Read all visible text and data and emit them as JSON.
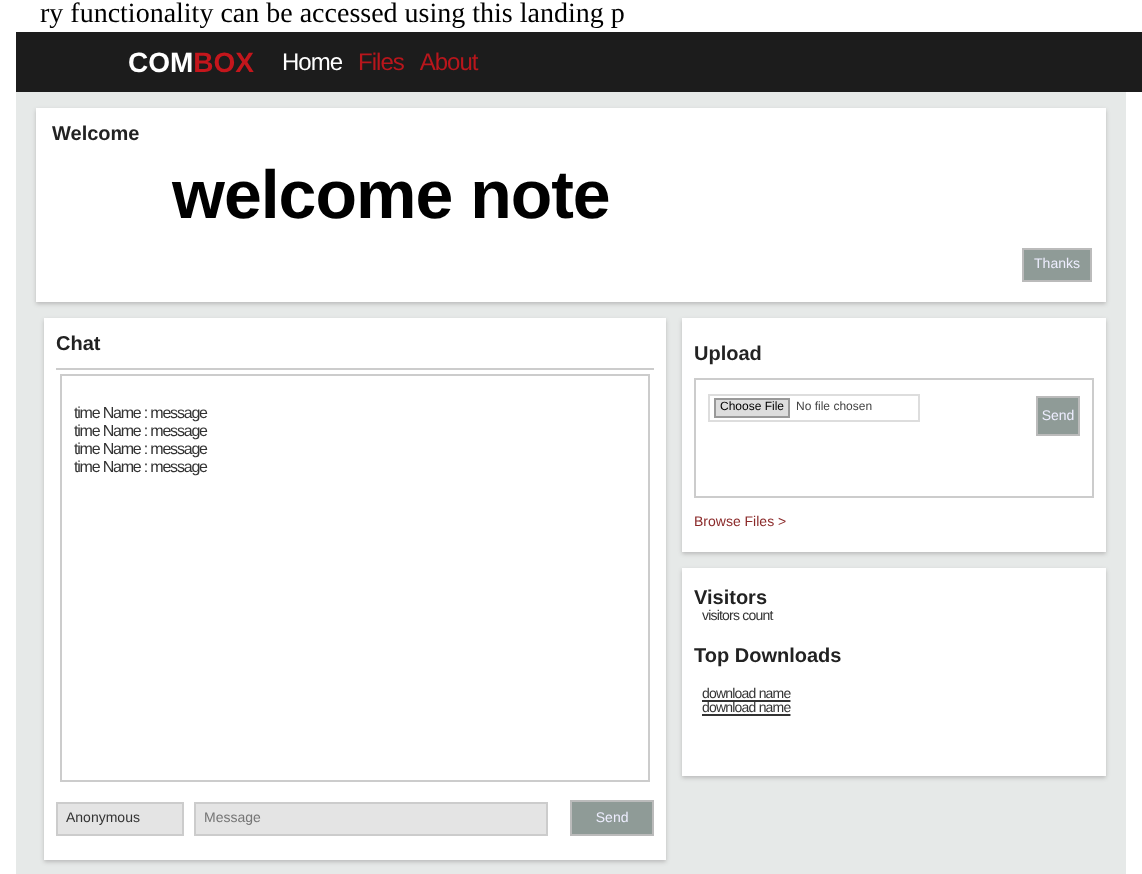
{
  "caption": "ry functionality can be accessed using this landing p",
  "nav": {
    "logo": [
      "COM",
      "BOX"
    ],
    "items": [
      {
        "label": "Home",
        "selected": true
      },
      {
        "label": "Files",
        "selected": false
      },
      {
        "label": "About",
        "selected": false
      }
    ]
  },
  "welcome": {
    "title": "Welcome",
    "note": "welcome note",
    "button": "Thanks"
  },
  "chat": {
    "title": "Chat",
    "messages": [
      "time Name : message",
      "time Name : message",
      "time Name : message",
      "time Name : message"
    ],
    "name_value": "Anonymous",
    "message_placeholder": "Message",
    "button": "Send"
  },
  "upload": {
    "title": "Upload",
    "choose_button": "Choose File",
    "file_status": "No file chosen",
    "send_button": "Send",
    "browse_link": "Browse Files >"
  },
  "visitors": {
    "title": "Visitors",
    "count": "visitors count"
  },
  "top_downloads": {
    "title": "Top Downloads",
    "items": [
      "download name",
      "download name"
    ]
  }
}
